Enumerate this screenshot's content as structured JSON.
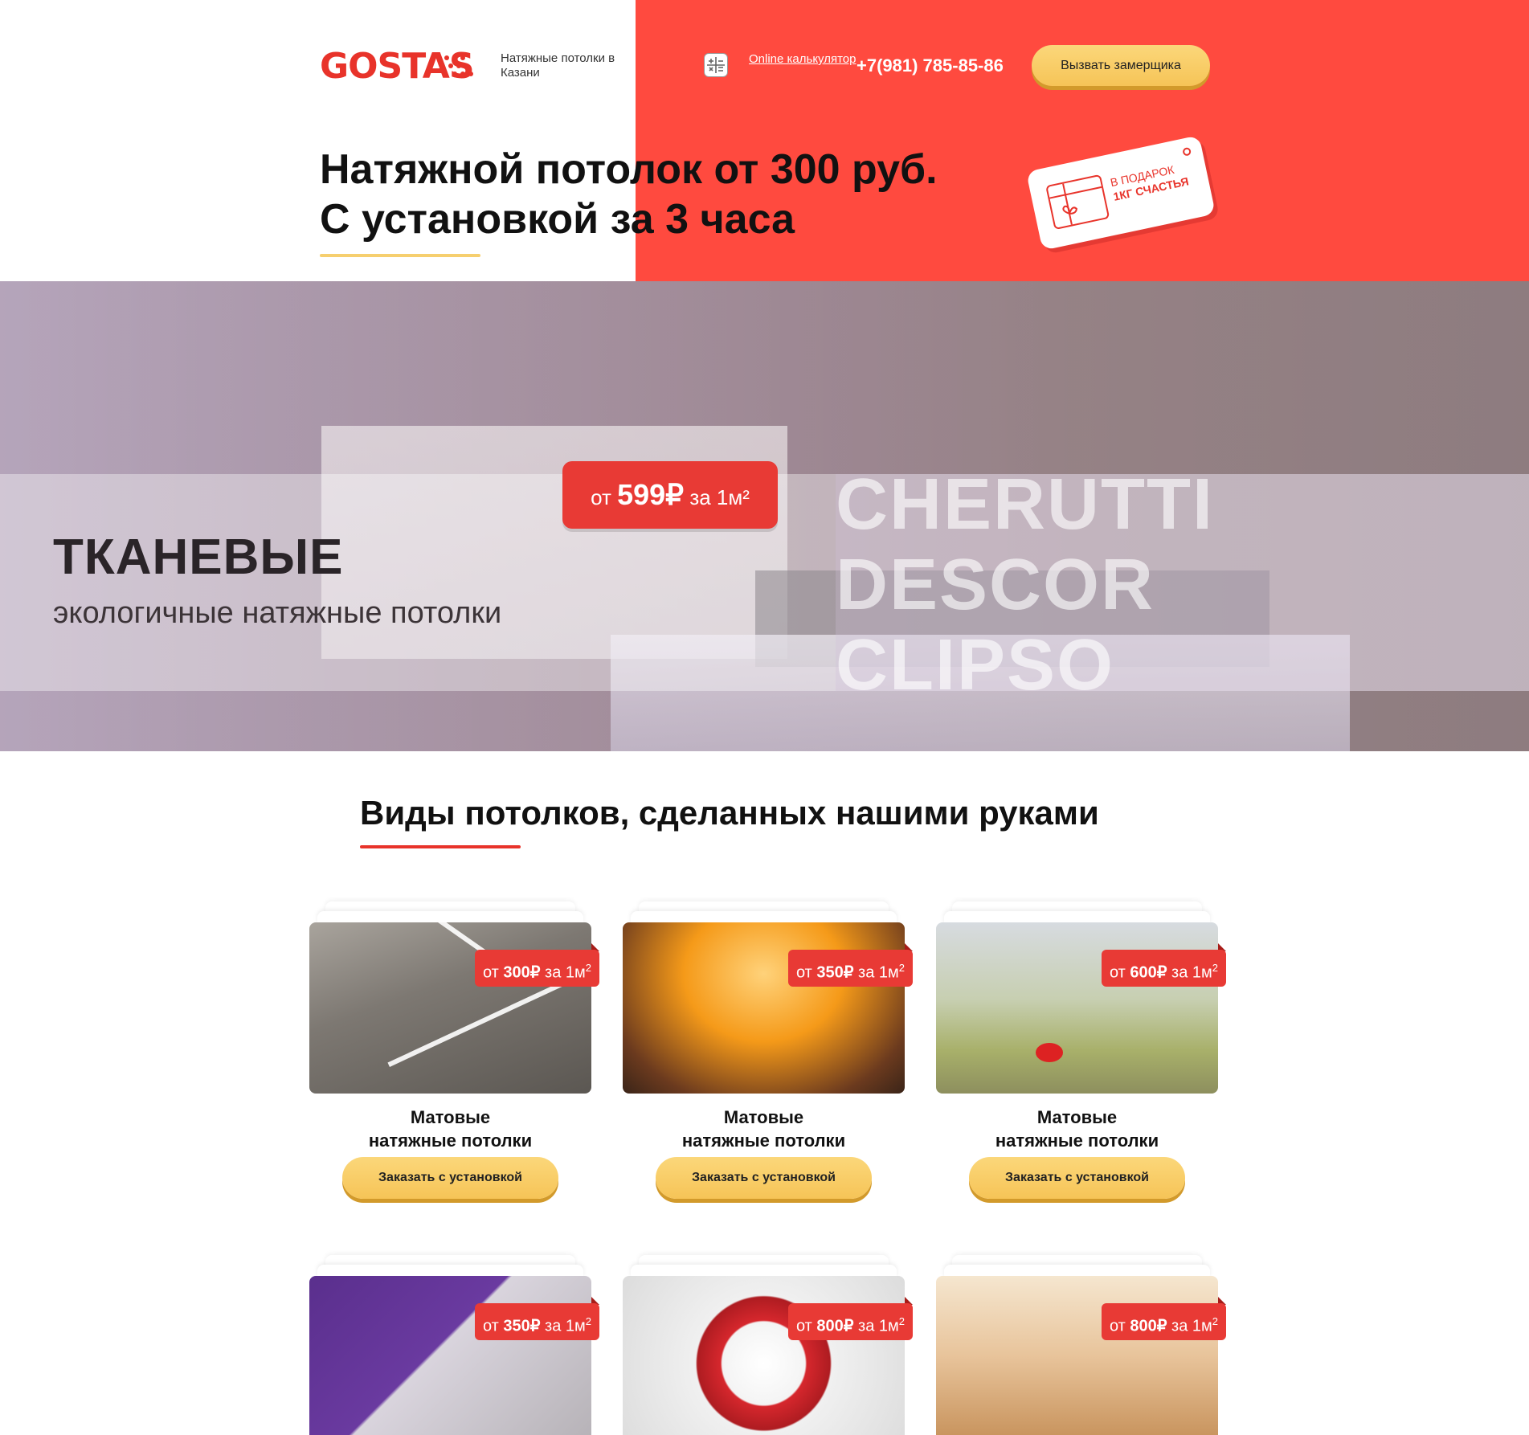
{
  "header": {
    "logo_text": "GOSTAS",
    "tagline": "Натяжные потолки в Казани",
    "calculator_link": "Online калькулятор",
    "phone": "+7(981) 785-85-86",
    "call_button": "Вызвать замерщика"
  },
  "hero": {
    "headline_line1": "Натяжной потолок от 300 руб.",
    "headline_line2": "С установкой за 3 часа",
    "gift_line1": "В ПОДАРОК",
    "gift_line2": "1КГ СЧАСТЬЯ"
  },
  "banner": {
    "price_prefix": "от",
    "price_value": "599₽",
    "price_suffix": "за 1м²",
    "title": "ТКАНЕВЫЕ",
    "subtitle": "экологичные натяжные потолки",
    "brands": [
      "CHERUTTI",
      "DESCOR",
      "CLIPSO"
    ]
  },
  "section": {
    "title": "Виды потолков, сделанных нашими руками"
  },
  "cards": [
    {
      "price_prefix": "от",
      "price_value": "300₽",
      "price_suffix": "за 1м",
      "price_sup": "2",
      "title_line1": "Матовые",
      "title_line2": "натяжные потолки",
      "button": "Заказать с установкой"
    },
    {
      "price_prefix": "от",
      "price_value": "350₽",
      "price_suffix": "за 1м",
      "price_sup": "2",
      "title_line1": "Матовые",
      "title_line2": "натяжные потолки",
      "button": "Заказать с установкой"
    },
    {
      "price_prefix": "от",
      "price_value": "600₽",
      "price_suffix": "за 1м",
      "price_sup": "2",
      "title_line1": "Матовые",
      "title_line2": "натяжные потолки",
      "button": "Заказать с установкой"
    },
    {
      "price_prefix": "от",
      "price_value": "350₽",
      "price_suffix": "за 1м",
      "price_sup": "2"
    },
    {
      "price_prefix": "от",
      "price_value": "800₽",
      "price_suffix": "за 1м",
      "price_sup": "2"
    },
    {
      "price_prefix": "от",
      "price_value": "800₽",
      "price_suffix": "за 1м",
      "price_sup": "2"
    }
  ],
  "colors": {
    "brand_red": "#e8332a",
    "header_red": "#ff4a3f",
    "button_gold": "#f6c457"
  },
  "icons": [
    "calculator-icon",
    "gift-box-icon"
  ]
}
